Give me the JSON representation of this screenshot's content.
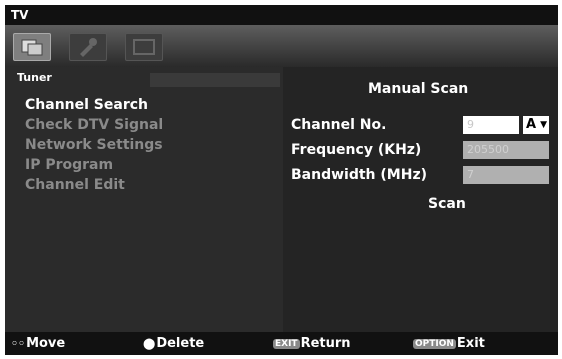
{
  "app": {
    "title": "TV"
  },
  "icons": [
    "setup-icon",
    "tools-icon",
    "picture-icon"
  ],
  "tuner": {
    "label": "Tuner"
  },
  "menu": {
    "items": [
      {
        "label": "Channel Search",
        "selected": true
      },
      {
        "label": "Check DTV Signal",
        "selected": false
      },
      {
        "label": "Network Settings",
        "selected": false
      },
      {
        "label": "IP Program",
        "selected": false
      },
      {
        "label": "Channel Edit",
        "selected": false
      }
    ]
  },
  "manual_scan": {
    "title": "Manual Scan",
    "channel_label": "Channel No.",
    "channel_value": "9",
    "channel_letter": "A",
    "frequency_label": "Frequency (KHz)",
    "frequency_value": "205500",
    "bandwidth_label": "Bandwidth (MHz)",
    "bandwidth_value": "7",
    "scan_label": "Scan"
  },
  "footer": {
    "move_label": "Move",
    "delete_label": "Delete",
    "return_key": "EXIT",
    "return_label": "Return",
    "exit_key": "OPTION",
    "exit_label": "Exit"
  }
}
